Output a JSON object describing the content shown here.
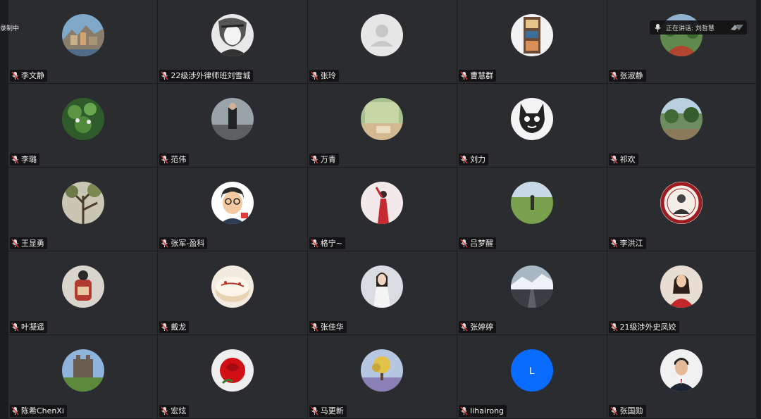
{
  "recording_label": "录制中",
  "speaking_label": "正在讲话: 刘哲慧",
  "colors": {
    "tile_bg": "#2b2c2f",
    "accent_blue": "#0a6cff"
  },
  "participants": [
    {
      "name": "李文静",
      "avatar": "landscape-coast-photo"
    },
    {
      "name": "22级涉外律师班刘雪城",
      "avatar": "anime-sketch"
    },
    {
      "name": "张玲",
      "avatar": "default-person-icon"
    },
    {
      "name": "曹慧群",
      "avatar": "city-street-photo"
    },
    {
      "name": "张淑静",
      "avatar": "garden-photo"
    },
    {
      "name": "李璐",
      "avatar": "green-leaves-photo"
    },
    {
      "name": "范伟",
      "avatar": "person-standing-photo"
    },
    {
      "name": "万青",
      "avatar": "painting-photo"
    },
    {
      "name": "刘力",
      "avatar": "cartoon-cat-drawing"
    },
    {
      "name": "祁欢",
      "avatar": "park-photo"
    },
    {
      "name": "王显勇",
      "avatar": "tree-photo"
    },
    {
      "name": "张军-盈科",
      "avatar": "cartoon-man-glasses"
    },
    {
      "name": "格宁~",
      "avatar": "red-dress-figure"
    },
    {
      "name": "吕梦醒",
      "avatar": "field-person-photo"
    },
    {
      "name": "李洪江",
      "avatar": "peking-university-seal"
    },
    {
      "name": "叶凝遥",
      "avatar": "backpack-person-photo"
    },
    {
      "name": "戴龙",
      "avatar": "christmas-cake-photo"
    },
    {
      "name": "张佳华",
      "avatar": "woman-portrait-photo"
    },
    {
      "name": "张婷婷",
      "avatar": "snowy-road-photo"
    },
    {
      "name": "21级涉外史凤姣",
      "avatar": "woman-red-sweater-photo"
    },
    {
      "name": "陈希ChenXi",
      "avatar": "castle-photo"
    },
    {
      "name": "宏炫",
      "avatar": "red-rose-photo"
    },
    {
      "name": "马更新",
      "avatar": "tree-painting"
    },
    {
      "name": "lihairong",
      "avatar": "letter-avatar",
      "letter": "L"
    },
    {
      "name": "张国勋",
      "avatar": "man-suit-portrait"
    }
  ]
}
